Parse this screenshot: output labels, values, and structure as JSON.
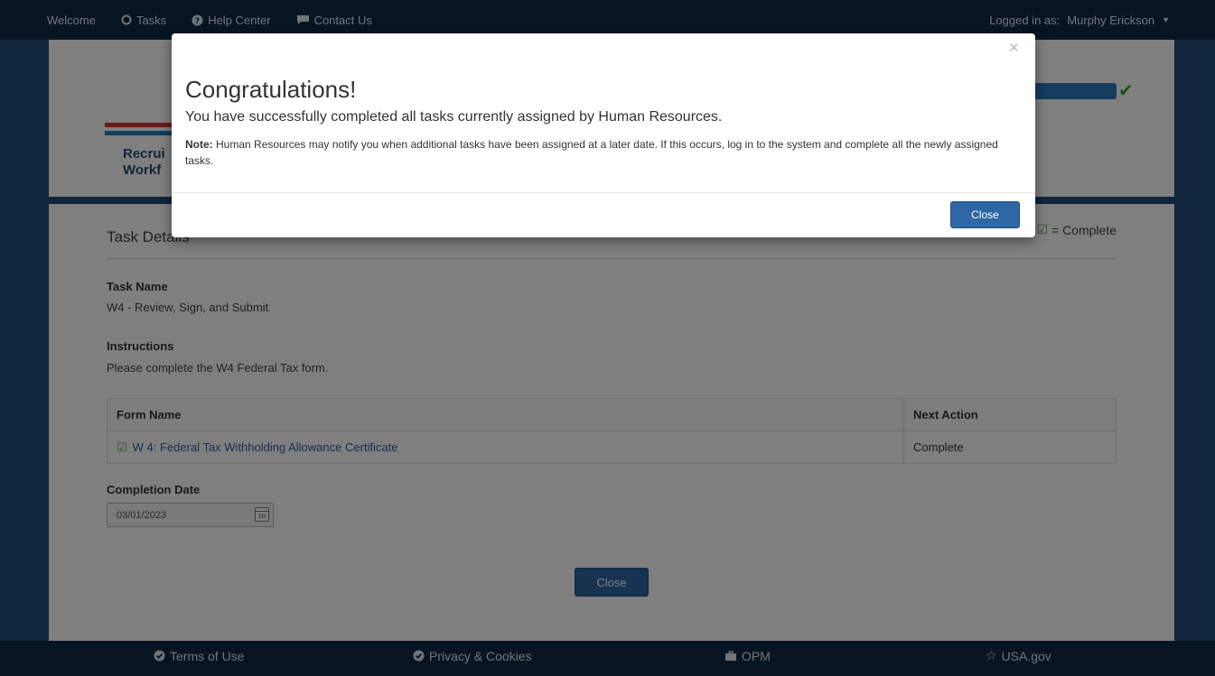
{
  "topnav": {
    "welcome": "Welcome",
    "tasks": "Tasks",
    "help": "Help Center",
    "contact": "Contact Us",
    "logged_in_label": "Logged in as:",
    "user_name": "Murphy Erickson"
  },
  "header": {
    "logo_text_line1": "Recrui",
    "logo_text_line2": "Workf",
    "progress_percent": 100
  },
  "task": {
    "title": "Task Details",
    "legend": "= Complete",
    "name_label": "Task Name",
    "name_value": "W4 - Review, Sign, and Submit",
    "instructions_label": "Instructions",
    "instructions_value": "Please complete the W4 Federal Tax form.",
    "table": {
      "headers": [
        "Form Name",
        "Next Action"
      ],
      "rows": [
        {
          "form": "W 4: Federal Tax Withholding Allowance Certificate",
          "action": "Complete"
        }
      ]
    },
    "completion_label": "Completion Date",
    "completion_value": "03/01/2023",
    "close_label": "Close"
  },
  "footer": {
    "terms": "Terms of Use",
    "privacy": "Privacy & Cookies",
    "opm": "OPM",
    "usagov": "USA.gov"
  },
  "modal": {
    "title": "Congratulations!",
    "subtitle": "You have successfully completed all tasks currently assigned by Human Resources.",
    "note_label": "Note:",
    "note_text": " Human Resources may notify you when additional tasks have been assigned at a later date. If this occurs, log in to the system and complete all the newly assigned tasks.",
    "close_label": "Close",
    "close_x": "×"
  },
  "colors": {
    "nav_bg": "#0e2a47",
    "page_bg": "#1f4a78",
    "button_bg": "#2d67a5",
    "complete_green": "#55a255",
    "link": "#2f5e9a"
  },
  "icons": {
    "tasks": "circle-outline-icon",
    "help": "question-circle-icon",
    "contact": "speech-bubble-icon",
    "terms": "check-circle-icon",
    "privacy": "check-circle-icon",
    "opm": "briefcase-icon",
    "usagov": "star-icon",
    "complete": "check-square-icon"
  }
}
